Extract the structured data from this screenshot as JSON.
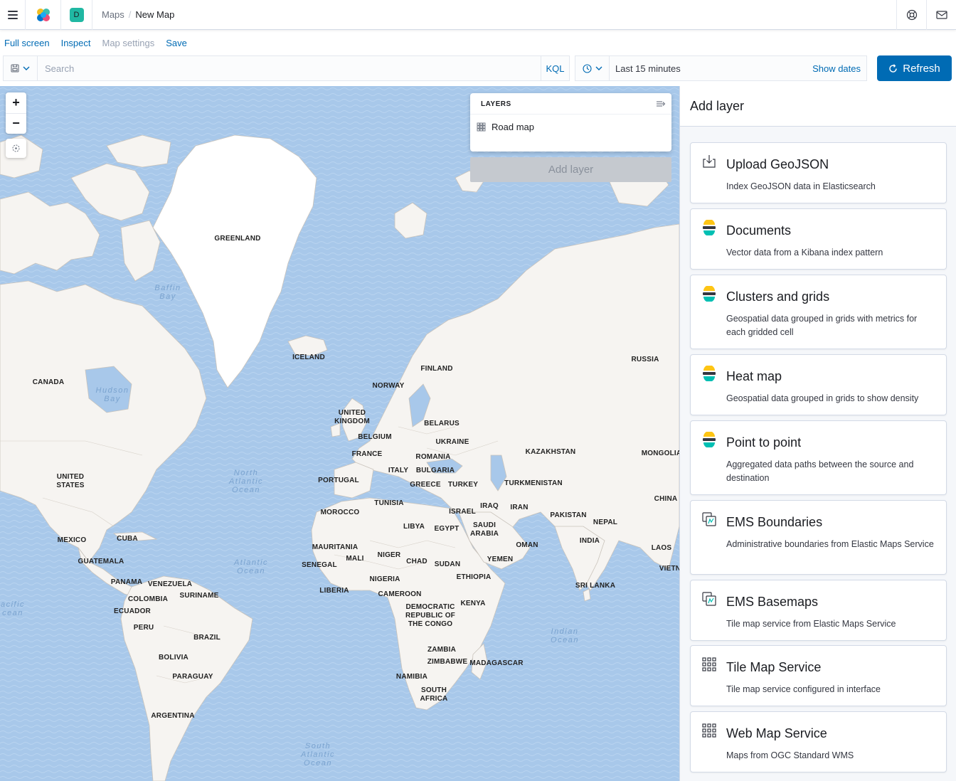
{
  "header": {
    "space_initial": "D",
    "breadcrumbs": [
      {
        "label": "Maps"
      },
      {
        "label": "New Map"
      }
    ],
    "icons": [
      "help-icon",
      "newsfeed-icon"
    ]
  },
  "topnav": {
    "full_screen": "Full screen",
    "inspect": "Inspect",
    "map_settings": "Map settings",
    "save": "Save"
  },
  "query": {
    "placeholder": "Search",
    "language": "KQL"
  },
  "time": {
    "label": "Last 15 minutes",
    "show_dates": "Show dates",
    "refresh": "Refresh"
  },
  "layers": {
    "title": "LAYERS",
    "items": [
      {
        "label": "Road map",
        "icon": "grid-icon"
      }
    ],
    "add_layer": "Add layer"
  },
  "map": {
    "zoom_in": "+",
    "zoom_out": "−",
    "countries": [
      {
        "name": "GREENLAND"
      },
      {
        "name": "ICELAND"
      },
      {
        "name": "RUSSIA"
      },
      {
        "name": "FINLAND"
      },
      {
        "name": "CANADA"
      },
      {
        "name": "NORWAY"
      },
      {
        "name": "UNITED\nKINGDOM"
      },
      {
        "name": "BELARUS"
      },
      {
        "name": "BELGIUM"
      },
      {
        "name": "UKRAINE"
      },
      {
        "name": "FRANCE"
      },
      {
        "name": "ROMANIA"
      },
      {
        "name": "KAZAKHSTAN"
      },
      {
        "name": "MONGOLIA"
      },
      {
        "name": "UNITED\nSTATES"
      },
      {
        "name": "ITALY"
      },
      {
        "name": "BULGARIA"
      },
      {
        "name": "PORTUGAL"
      },
      {
        "name": "GREECE"
      },
      {
        "name": "TURKEY"
      },
      {
        "name": "TURKMENISTAN"
      },
      {
        "name": "CHINA"
      },
      {
        "name": "TUNISIA"
      },
      {
        "name": "MOROCCO"
      },
      {
        "name": "IRAQ"
      },
      {
        "name": "IRAN"
      },
      {
        "name": "ISRAEL"
      },
      {
        "name": "PAKISTAN"
      },
      {
        "name": "NEPAL"
      },
      {
        "name": "LIBYA"
      },
      {
        "name": "EGYPT"
      },
      {
        "name": "SAUDI\nARABIA"
      },
      {
        "name": "MEXICO"
      },
      {
        "name": "CUBA"
      },
      {
        "name": "INDIA"
      },
      {
        "name": "OMAN"
      },
      {
        "name": "LAOS"
      },
      {
        "name": "MAURITANIA"
      },
      {
        "name": "MALI"
      },
      {
        "name": "NIGER"
      },
      {
        "name": "CHAD"
      },
      {
        "name": "SUDAN"
      },
      {
        "name": "YEMEN"
      },
      {
        "name": "GUATEMALA"
      },
      {
        "name": "SENEGAL"
      },
      {
        "name": "VIETN"
      },
      {
        "name": "ETHIOPIA"
      },
      {
        "name": "PANAMA"
      },
      {
        "name": "VENEZUELA"
      },
      {
        "name": "NIGERIA"
      },
      {
        "name": "SRI LANKA"
      },
      {
        "name": "LIBERIA"
      },
      {
        "name": "SURINAME"
      },
      {
        "name": "COLOMBIA"
      },
      {
        "name": "CAMEROON"
      },
      {
        "name": "KENYA"
      },
      {
        "name": "ECUADOR"
      },
      {
        "name": "DEMOCRATIC\nREPUBLIC OF\nTHE CONGO"
      },
      {
        "name": "PERU"
      },
      {
        "name": "BRAZIL"
      },
      {
        "name": "ZAMBIA"
      },
      {
        "name": "BOLIVIA"
      },
      {
        "name": "ZIMBABWE"
      },
      {
        "name": "MADAGASCAR"
      },
      {
        "name": "PARAGUAY"
      },
      {
        "name": "NAMIBIA"
      },
      {
        "name": "SOUTH\nAFRICA"
      },
      {
        "name": "ARGENTINA"
      }
    ],
    "oceans": [
      {
        "name": "Baffin\nBay"
      },
      {
        "name": "Hudson\nBay"
      },
      {
        "name": "North\nAtlantic\nOcean"
      },
      {
        "name": "Atlantic\nOcean"
      },
      {
        "name": "acific\ncean"
      },
      {
        "name": "Indian\nOcean"
      },
      {
        "name": "South\nAtlantic\nOcean"
      }
    ]
  },
  "add_layer_panel": {
    "title": "Add layer",
    "cards": [
      {
        "title": "Upload GeoJSON",
        "desc": "Index GeoJSON data in Elasticsearch",
        "icon": "upload-icon"
      },
      {
        "title": "Documents",
        "desc": "Vector data from a Kibana index pattern",
        "icon": "elasticsearch-icon"
      },
      {
        "title": "Clusters and grids",
        "desc": "Geospatial data grouped in grids with metrics for each gridded cell",
        "icon": "elasticsearch-icon"
      },
      {
        "title": "Heat map",
        "desc": "Geospatial data grouped in grids to show density",
        "icon": "elasticsearch-icon"
      },
      {
        "title": "Point to point",
        "desc": "Aggregated data paths between the source and destination",
        "icon": "elasticsearch-icon"
      },
      {
        "title": "EMS Boundaries",
        "desc": "Administrative boundaries from Elastic Maps Service",
        "icon": "ems-icon"
      },
      {
        "title": "EMS Basemaps",
        "desc": "Tile map service from Elastic Maps Service",
        "icon": "ems-icon"
      },
      {
        "title": "Tile Map Service",
        "desc": "Tile map service configured in interface",
        "icon": "grid-icon"
      },
      {
        "title": "Web Map Service",
        "desc": "Maps from OGC Standard WMS",
        "icon": "grid-icon"
      }
    ]
  },
  "colors": {
    "accent": "#006bb4",
    "ocean": "#a8c8ea",
    "land": "#f6f4f1"
  }
}
